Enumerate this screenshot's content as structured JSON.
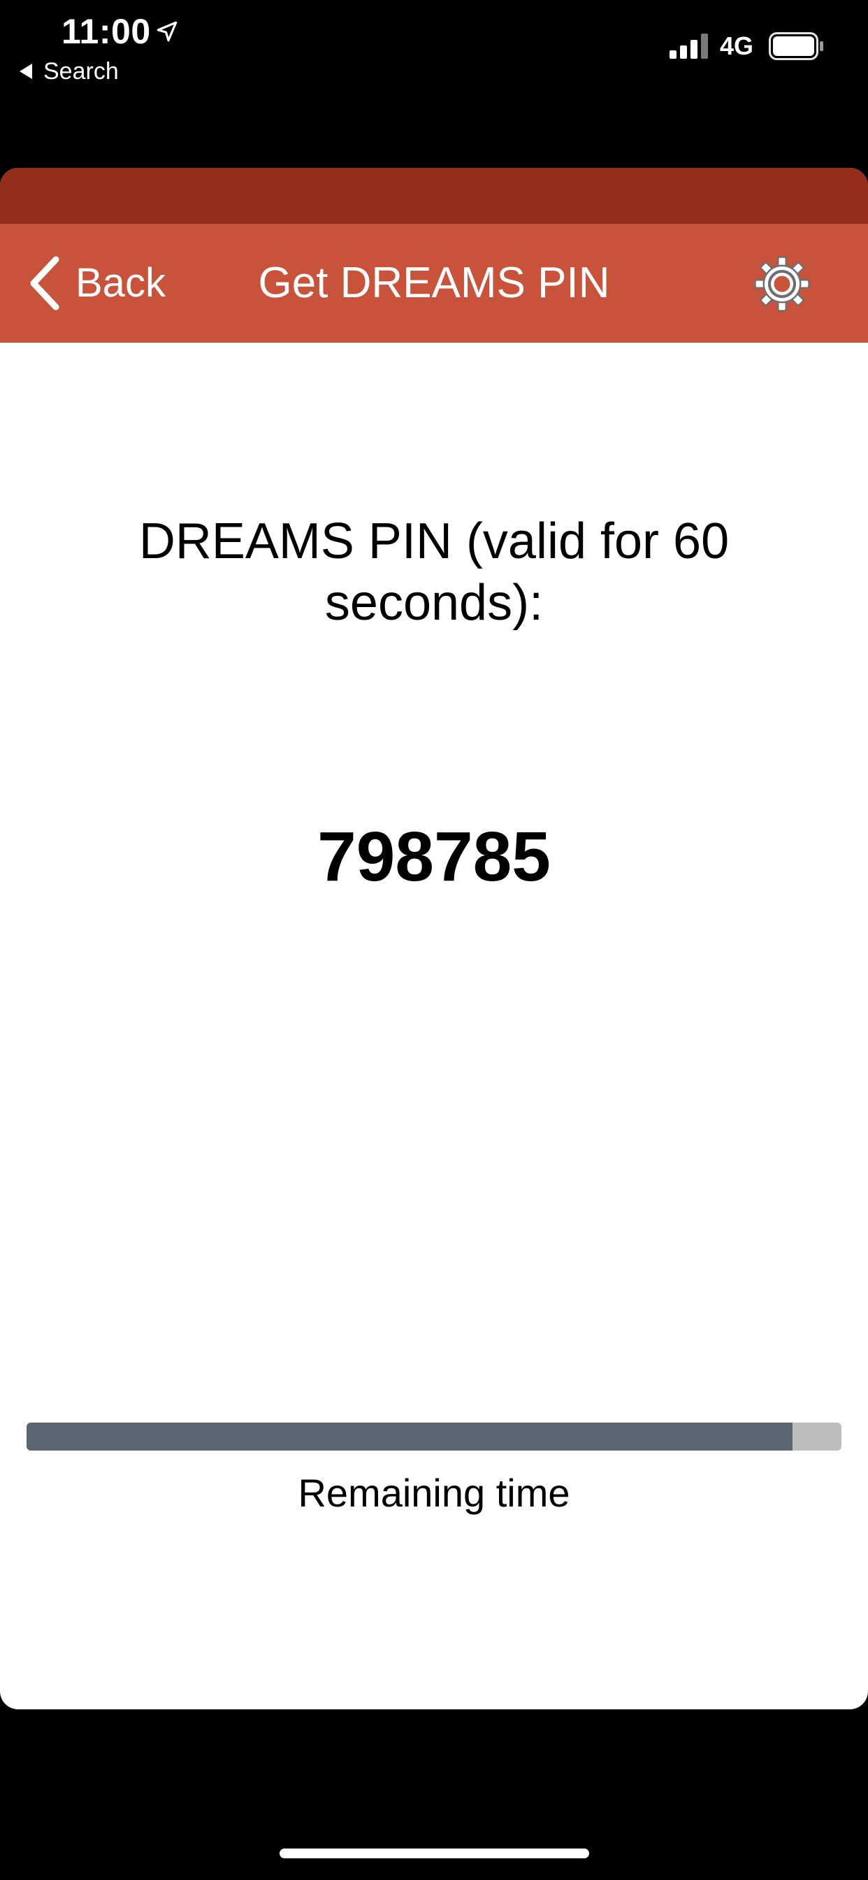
{
  "status_bar": {
    "time": "11:00",
    "back_app_label": "Search",
    "network": "4G",
    "icons": [
      "location-arrow-icon",
      "cellular-signal-icon",
      "battery-icon"
    ]
  },
  "nav": {
    "back_label": "Back",
    "title": "Get DREAMS PIN",
    "settings_icon": "gear-icon"
  },
  "main": {
    "pin_label": "DREAMS PIN (valid for 60 seconds):",
    "pin_value": "798785",
    "remaining_label": "Remaining time",
    "remaining_fraction": 0.94
  },
  "colors": {
    "header_dark": "#922e1a",
    "header": "#c9533a",
    "progress_fill": "#5c6670",
    "progress_track": "#bdbdbd"
  }
}
